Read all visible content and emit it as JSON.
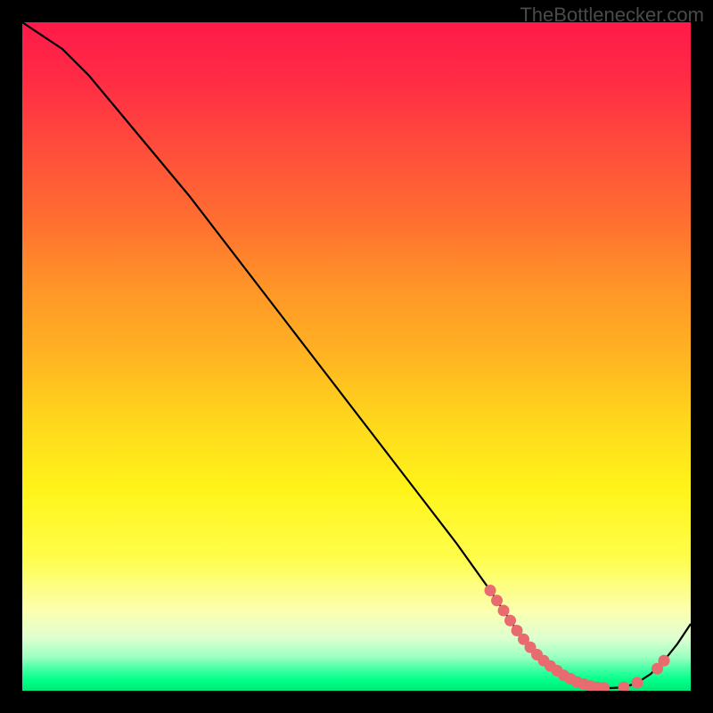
{
  "attribution": "TheBottlenecker.com",
  "chart_data": {
    "type": "line",
    "title": "",
    "xlabel": "",
    "ylabel": "",
    "xlim": [
      0,
      100
    ],
    "ylim": [
      0,
      100
    ],
    "x": [
      0,
      6,
      10,
      15,
      20,
      25,
      30,
      35,
      40,
      45,
      50,
      55,
      60,
      65,
      70,
      72,
      74,
      76,
      78,
      80,
      82,
      84,
      86,
      88,
      90,
      92,
      94,
      96,
      98,
      100
    ],
    "values": [
      100,
      96,
      92,
      86,
      80,
      74,
      67.5,
      61,
      54.5,
      48,
      41.5,
      35,
      28.5,
      22,
      15,
      12,
      9,
      6.5,
      4.5,
      3,
      1.8,
      1,
      0.5,
      0.4,
      0.5,
      1.2,
      2.5,
      4.5,
      7,
      10
    ],
    "highlight_points": {
      "x": [
        70,
        71,
        72,
        73,
        74,
        75,
        76,
        77,
        78,
        79,
        80,
        81,
        82,
        83,
        84,
        85,
        86,
        87,
        90,
        92,
        95,
        96
      ],
      "y": [
        15,
        13.5,
        12,
        10.5,
        9,
        7.7,
        6.5,
        5.4,
        4.5,
        3.7,
        3,
        2.3,
        1.8,
        1.3,
        1,
        0.7,
        0.5,
        0.4,
        0.5,
        1.2,
        3.3,
        4.5
      ],
      "color": "#e86b6f"
    },
    "line_color": "#000000",
    "background_gradient": [
      "#ff1a49",
      "#ff9628",
      "#fff41a",
      "#00e878"
    ]
  }
}
